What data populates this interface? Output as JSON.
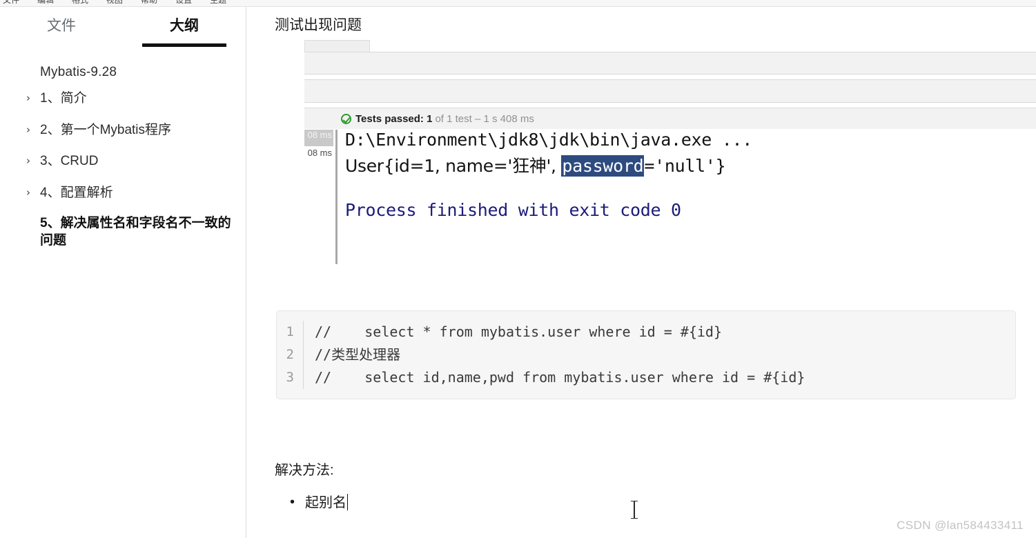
{
  "top_toolbar": {
    "items": [
      "文件",
      "编辑",
      "格式",
      "视图",
      "帮助",
      "设置",
      "主题"
    ]
  },
  "sidebar": {
    "tabs": [
      {
        "label": "文件",
        "active": false
      },
      {
        "label": "大纲",
        "active": true
      }
    ],
    "outline": {
      "root": "Mybatis-9.28",
      "items": [
        {
          "label": "1、简介",
          "expandable": true,
          "active": false
        },
        {
          "label": "2、第一个Mybatis程序",
          "expandable": true,
          "active": false
        },
        {
          "label": "3、CRUD",
          "expandable": true,
          "active": false
        },
        {
          "label": "4、配置解析",
          "expandable": true,
          "active": false
        },
        {
          "label": "5、解决属性名和字段名不一致的问题",
          "expandable": false,
          "active": true
        }
      ],
      "chevron": "›"
    }
  },
  "main": {
    "title": "测试出现问题",
    "ide": {
      "status": {
        "strong": "Tests passed: 1",
        "dim": "of 1 test – 1 s 408 ms",
        "icon": "check-circle-icon"
      },
      "gutter_times": [
        "08 ms",
        "08 ms"
      ],
      "console": {
        "line1": "D:\\Environment\\jdk8\\jdk\\bin\\java.exe ...",
        "line2_prefix": "User{id=1, name='狂神', ",
        "line2_selected": "password",
        "line2_suffix": "='null'}",
        "line3": "Process finished with exit code 0"
      }
    },
    "code": {
      "lines": [
        {
          "num": "1",
          "text": "//    select * from mybatis.user where id = #{id}"
        },
        {
          "num": "2",
          "text": "//类型处理器"
        },
        {
          "num": "3",
          "text": "//    select id,name,pwd from mybatis.user where id = #{id}"
        }
      ]
    },
    "solution": {
      "title": "解决方法:",
      "items": [
        "起别名"
      ]
    }
  },
  "watermark": "CSDN @lan584433411",
  "colors": {
    "accent": "#111111",
    "selection_blue": "#2e4b80",
    "console_green": "#eaf3e6",
    "process_navy": "#1b1b7a",
    "pass_green": "#2e9b2e"
  }
}
